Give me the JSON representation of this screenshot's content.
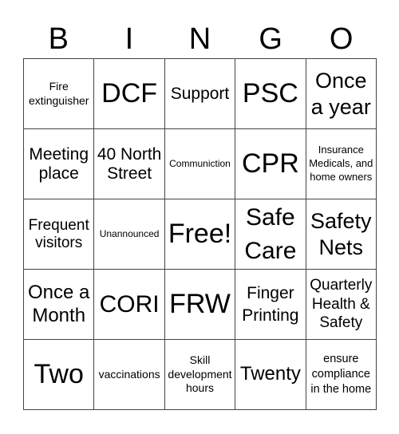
{
  "header": {
    "letters": [
      "B",
      "I",
      "N",
      "G",
      "O"
    ]
  },
  "cells": [
    [
      "Fire extinguisher",
      "DCF",
      "Support",
      "PSC",
      "Once a year"
    ],
    [
      "Meeting place",
      "40 North Street",
      "Communiction",
      "CPR",
      "Insurance Medicals, and home owners"
    ],
    [
      "Frequent visitors",
      "Unannounced",
      "Free!",
      "Safe Care",
      "Safety Nets"
    ],
    [
      "Once a Month",
      "CORI",
      "FRW",
      "Finger Printing",
      "Quarterly Health & Safety"
    ],
    [
      "Two",
      "vaccinations",
      "Skill development hours",
      "Twenty",
      "ensure compliance in the home"
    ]
  ]
}
